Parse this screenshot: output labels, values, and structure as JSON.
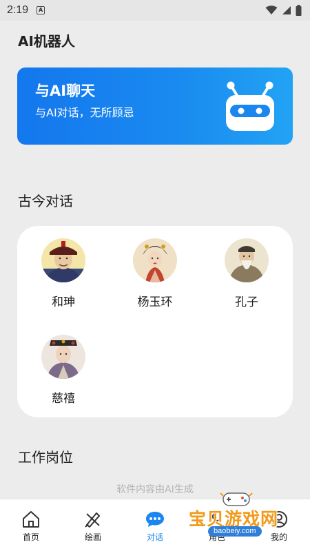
{
  "status": {
    "time": "2:19",
    "notif": "A"
  },
  "app": {
    "title": "AI机器人"
  },
  "banner": {
    "title": "与AI聊天",
    "subtitle": "与AI对话，无所顾忌"
  },
  "sections": {
    "ancient": "古今对话",
    "jobs": "工作岗位"
  },
  "characters": [
    {
      "name": "和珅",
      "avatar": "heshen-portrait"
    },
    {
      "name": "杨玉环",
      "avatar": "yang-yuhuan-portrait"
    },
    {
      "name": "孔子",
      "avatar": "confucius-portrait"
    },
    {
      "name": "慈禧",
      "avatar": "cixi-portrait"
    }
  ],
  "footer": {
    "note": "软件内容由AI生成"
  },
  "nav": [
    {
      "label": "首页",
      "icon": "home-icon",
      "active": false
    },
    {
      "label": "绘画",
      "icon": "brush-icon",
      "active": false
    },
    {
      "label": "对话",
      "icon": "chat-icon",
      "active": true
    },
    {
      "label": "角色",
      "icon": "role-icon",
      "active": false
    },
    {
      "label": "我的",
      "icon": "user-icon",
      "active": false
    }
  ],
  "watermark": {
    "text": "宝贝游戏网",
    "url": "baobeiy.com"
  },
  "colors": {
    "accent": "#1a86f0",
    "banner_start": "#1477ee",
    "banner_end": "#22a3f4",
    "watermark": "#f29a1a"
  }
}
